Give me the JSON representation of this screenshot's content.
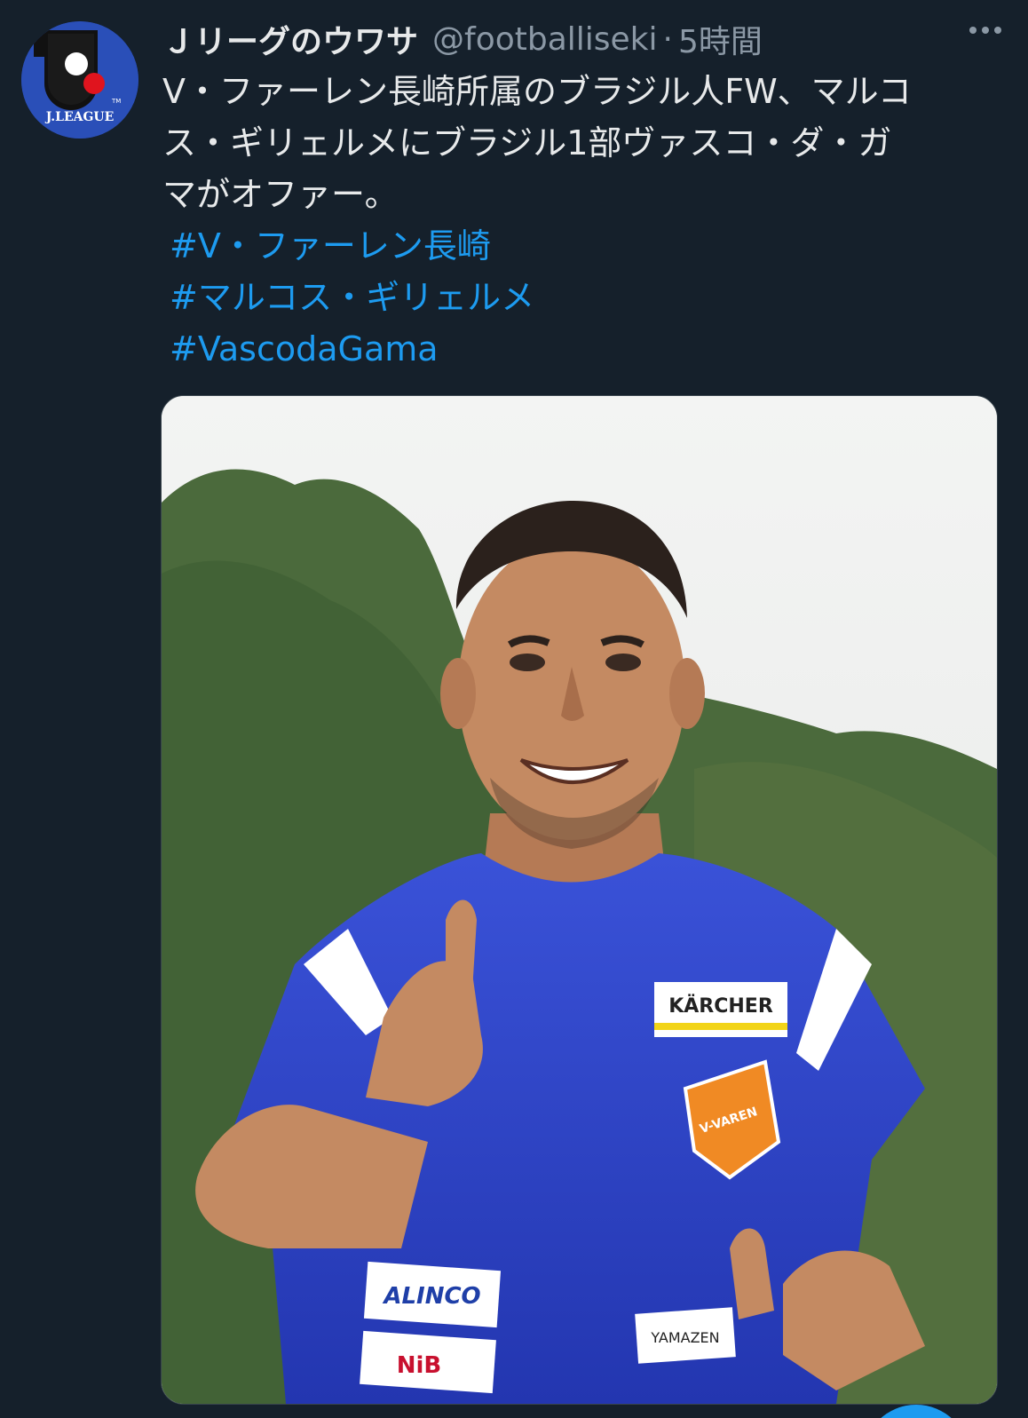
{
  "author": {
    "display_name": "Ｊリーグのウワサ",
    "handle": "@footballiseki",
    "separator": "·",
    "time": "5時間",
    "avatar_logo_text": "J.LEAGUE"
  },
  "tweet": {
    "text_lines": [
      "V・ファーレン長崎所属のブラジル人FW、マルコ",
      "ス・ギリェルメにブラジル1部ヴァスコ・ダ・ガ",
      "マがオファー。"
    ],
    "hashtags": [
      "#V・ファーレン長崎",
      "#マルコス・ギリェルメ",
      "#VascodaGama"
    ]
  },
  "media": {
    "jersey_sponsors": [
      "KÄRCHER",
      "ALINCO",
      "NiB",
      "YAMAZEN"
    ],
    "club_badge_text": "V-VAREN"
  },
  "colors": {
    "background": "#15202b",
    "text": "#e7e9ea",
    "secondary": "#8b98a5",
    "link": "#1d9bf0"
  }
}
